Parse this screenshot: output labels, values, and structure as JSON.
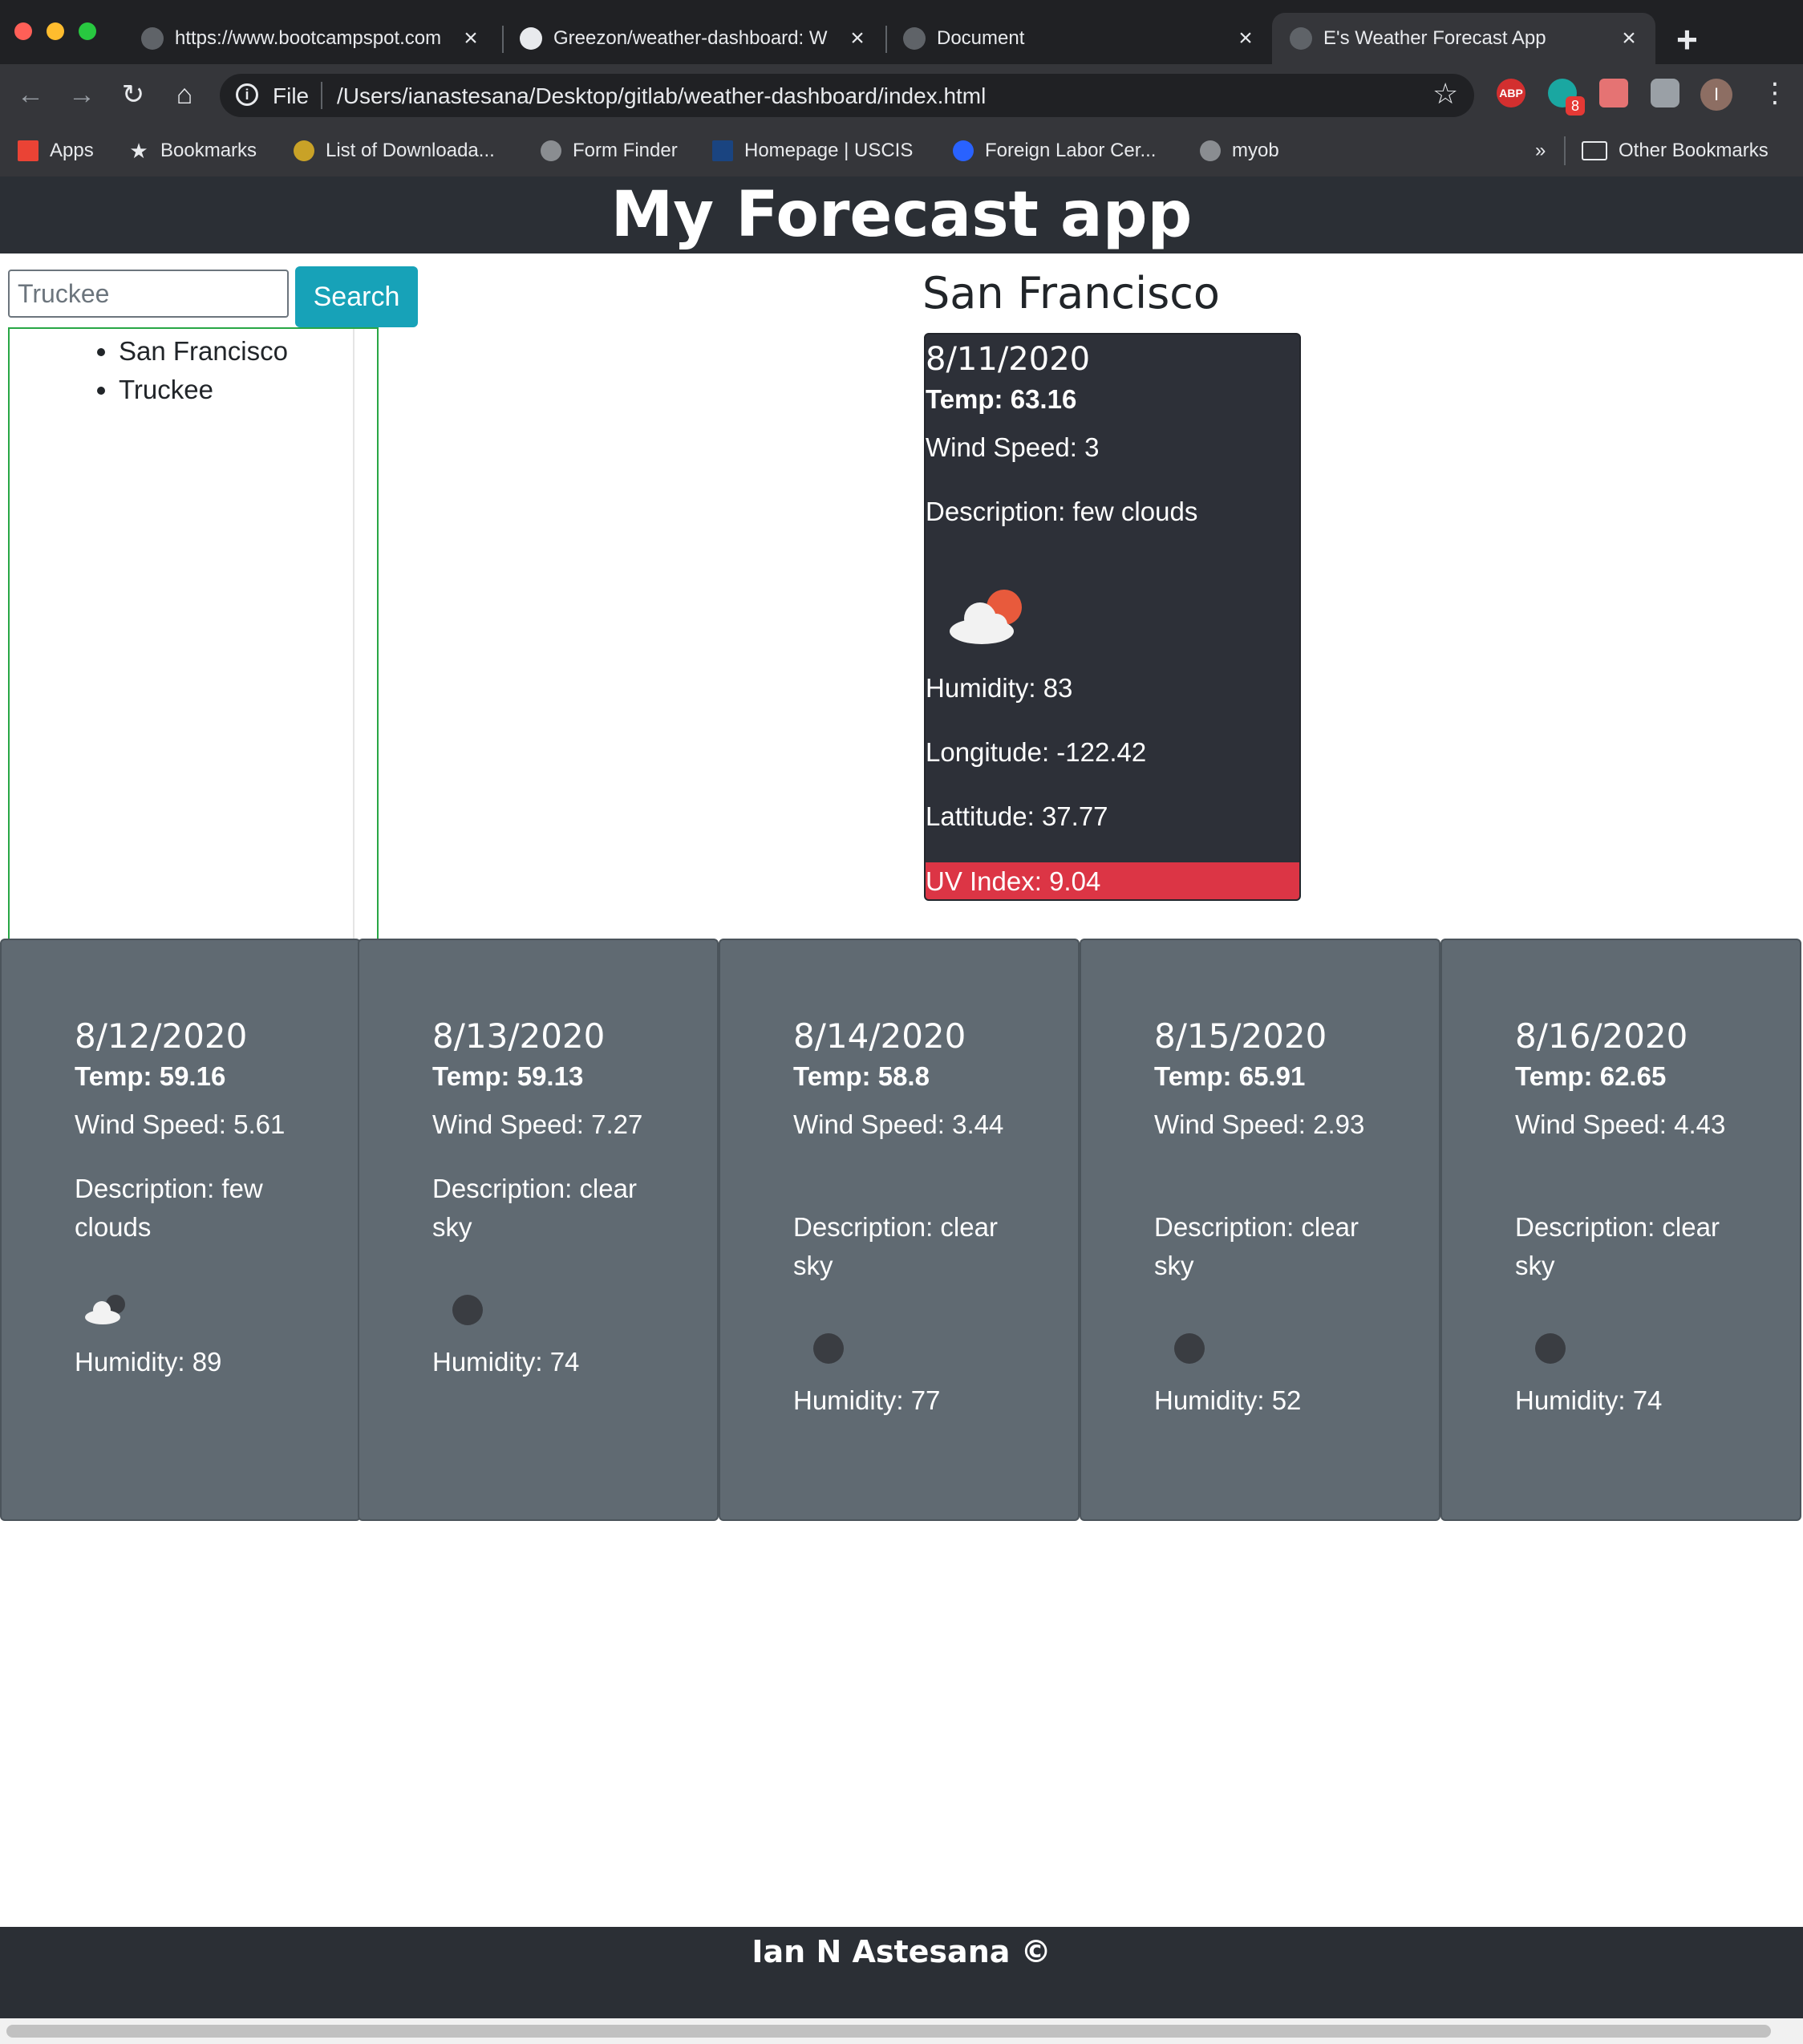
{
  "browser": {
    "tabs": [
      {
        "title": "https://www.bootcampspot.com",
        "active": false
      },
      {
        "title": "Greezon/weather-dashboard: W",
        "active": false
      },
      {
        "title": "Document",
        "active": false
      },
      {
        "title": "E's Weather Forecast App",
        "active": true
      }
    ],
    "new_tab": "+",
    "address_prefix": "File",
    "address": "/Users/ianastesana/Desktop/gitlab/weather-dashboard/index.html",
    "extension_badge": "8",
    "abp_label": "ABP",
    "profile_initial": "I",
    "bookmarks": [
      "Apps",
      "Bookmarks",
      "List of Downloada...",
      "Form Finder",
      "Homepage | USCIS",
      "Foreign Labor Cer...",
      "myob"
    ],
    "more_bookmarks": "»",
    "other_bookmarks": "Other Bookmarks"
  },
  "header": {
    "title": "My Forecast app"
  },
  "search": {
    "value": "Truckee",
    "button": "Search"
  },
  "history": [
    "San Francisco",
    "Truckee"
  ],
  "current": {
    "city": "San Francisco",
    "date": "8/11/2020",
    "temp": "Temp: 63.16",
    "wind": "Wind Speed: 3",
    "description": "Description: few clouds",
    "icon": "few-clouds-icon",
    "humidity": "Humidity: 83",
    "longitude": "Longitude: -122.42",
    "latitude": "Lattitude: 37.77",
    "uv": "UV Index: 9.04",
    "uv_color": "#dc3545"
  },
  "forecast": [
    {
      "date": "8/12/2020",
      "temp": "Temp: 59.16",
      "wind": "Wind Speed: 5.61",
      "description": "Description: few clouds",
      "icon": "few-clouds-icon",
      "humidity": "Humidity: 89"
    },
    {
      "date": "8/13/2020",
      "temp": "Temp: 59.13",
      "wind": "Wind Speed: 7.27",
      "description": "Description: clear sky",
      "icon": "clear-sky-icon",
      "humidity": "Humidity: 74"
    },
    {
      "date": "8/14/2020",
      "temp": "Temp: 58.8",
      "wind": "Wind Speed: 3.44",
      "description": "Description: clear sky",
      "icon": "clear-sky-icon",
      "humidity": "Humidity: 77"
    },
    {
      "date": "8/15/2020",
      "temp": "Temp: 65.91",
      "wind": "Wind Speed: 2.93",
      "description": "Description: clear sky",
      "icon": "clear-sky-icon",
      "humidity": "Humidity: 52"
    },
    {
      "date": "8/16/2020",
      "temp": "Temp: 62.65",
      "wind": "Wind Speed: 4.43",
      "description": "Description: clear sky",
      "icon": "clear-sky-icon",
      "humidity": "Humidity: 74"
    }
  ],
  "footer": {
    "text": "Ian N Astesana ©"
  }
}
